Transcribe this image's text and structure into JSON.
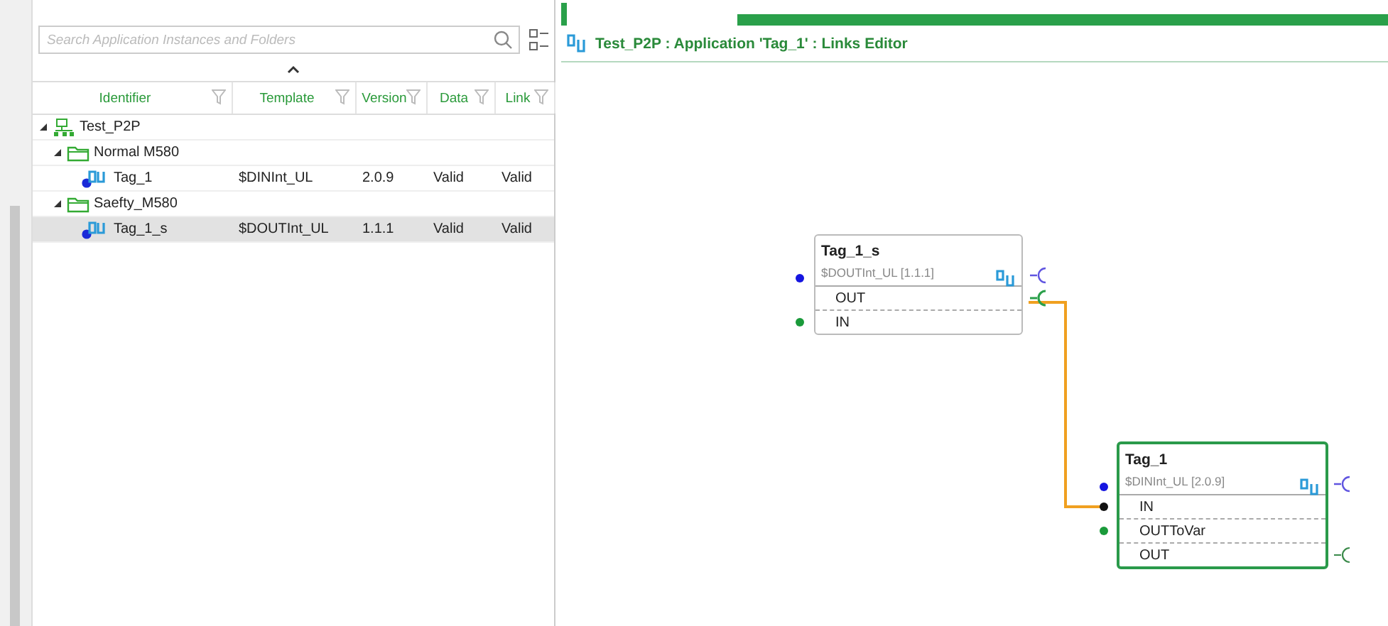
{
  "tree_panel": {
    "search": {
      "placeholder": "Search Application Instances and Folders"
    },
    "columns": [
      "Identifier",
      "Template",
      "Version",
      "Data",
      "Link"
    ],
    "rows": [
      {
        "kind": "project",
        "label": "Test_P2P",
        "expanded": true,
        "selected": false,
        "children": [
          {
            "kind": "folder",
            "label": "Normal M580",
            "expanded": true,
            "selected": false,
            "children": [
              {
                "kind": "instance",
                "label": "Tag_1",
                "cells": [
                  "$DINInt_UL",
                  "2.0.9",
                  "Valid",
                  "Valid"
                ],
                "selected": false
              }
            ]
          },
          {
            "kind": "folder",
            "label": "Saefty_M580",
            "expanded": true,
            "selected": false,
            "children": [
              {
                "kind": "instance",
                "label": "Tag_1_s",
                "cells": [
                  "$DOUTInt_UL",
                  "1.1.1",
                  "Valid",
                  "Valid"
                ],
                "selected": true
              }
            ]
          }
        ]
      }
    ]
  },
  "editor": {
    "title": "Test_P2P : Application 'Tag_1' : Links Editor",
    "nodes": [
      {
        "title": "Tag_1_s",
        "template": "$DOUTInt_UL [1.1.1]",
        "selected": false,
        "ports": [
          {
            "label": "OUT",
            "kind": "output",
            "connected": true
          },
          {
            "label": "IN",
            "kind": "input",
            "connected": false
          }
        ]
      },
      {
        "title": "Tag_1",
        "template": "$DINInt_UL [2.0.9]",
        "selected": true,
        "ports": [
          {
            "label": "IN",
            "kind": "input",
            "connected": true
          },
          {
            "label": "OUTToVar",
            "kind": "input",
            "connected": false
          },
          {
            "label": "OUT",
            "kind": "output",
            "connected": false
          }
        ]
      }
    ]
  }
}
